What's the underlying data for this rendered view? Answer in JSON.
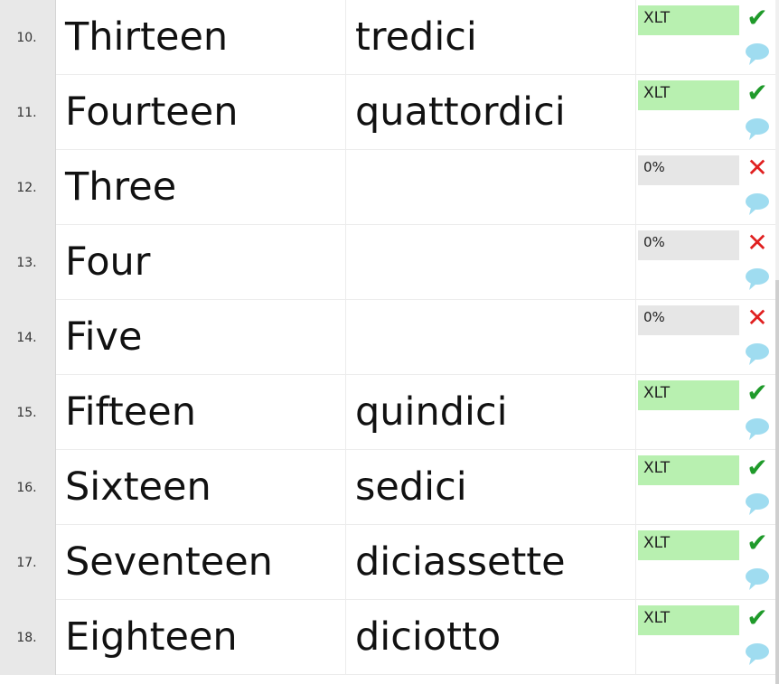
{
  "rows": [
    {
      "num": "10.",
      "source": "Thirteen",
      "target": "tredici",
      "badge": "XLT",
      "state": "ok"
    },
    {
      "num": "11.",
      "source": "Fourteen",
      "target": "quattordici",
      "badge": "XLT",
      "state": "ok"
    },
    {
      "num": "12.",
      "source": "Three",
      "target": "",
      "badge": "0%",
      "state": "bad"
    },
    {
      "num": "13.",
      "source": "Four",
      "target": "",
      "badge": "0%",
      "state": "bad"
    },
    {
      "num": "14.",
      "source": "Five",
      "target": "",
      "badge": "0%",
      "state": "bad"
    },
    {
      "num": "15.",
      "source": "Fifteen",
      "target": "quindici",
      "badge": "XLT",
      "state": "ok"
    },
    {
      "num": "16.",
      "source": "Sixteen",
      "target": "sedici",
      "badge": "XLT",
      "state": "ok"
    },
    {
      "num": "17.",
      "source": "Seventeen",
      "target": "diciassette",
      "badge": "XLT",
      "state": "ok"
    },
    {
      "num": "18.",
      "source": "Eighteen",
      "target": "diciotto",
      "badge": "XLT",
      "state": "ok"
    }
  ],
  "icons": {
    "ok": "check-icon",
    "bad": "cross-icon",
    "comment": "comment-bubble-icon"
  },
  "colors": {
    "xlt_badge": "#b8f0b0",
    "empty_badge": "#e6e6e6",
    "check": "#1f9a2a",
    "cross": "#e02020",
    "comment": "#9fdcf0"
  }
}
